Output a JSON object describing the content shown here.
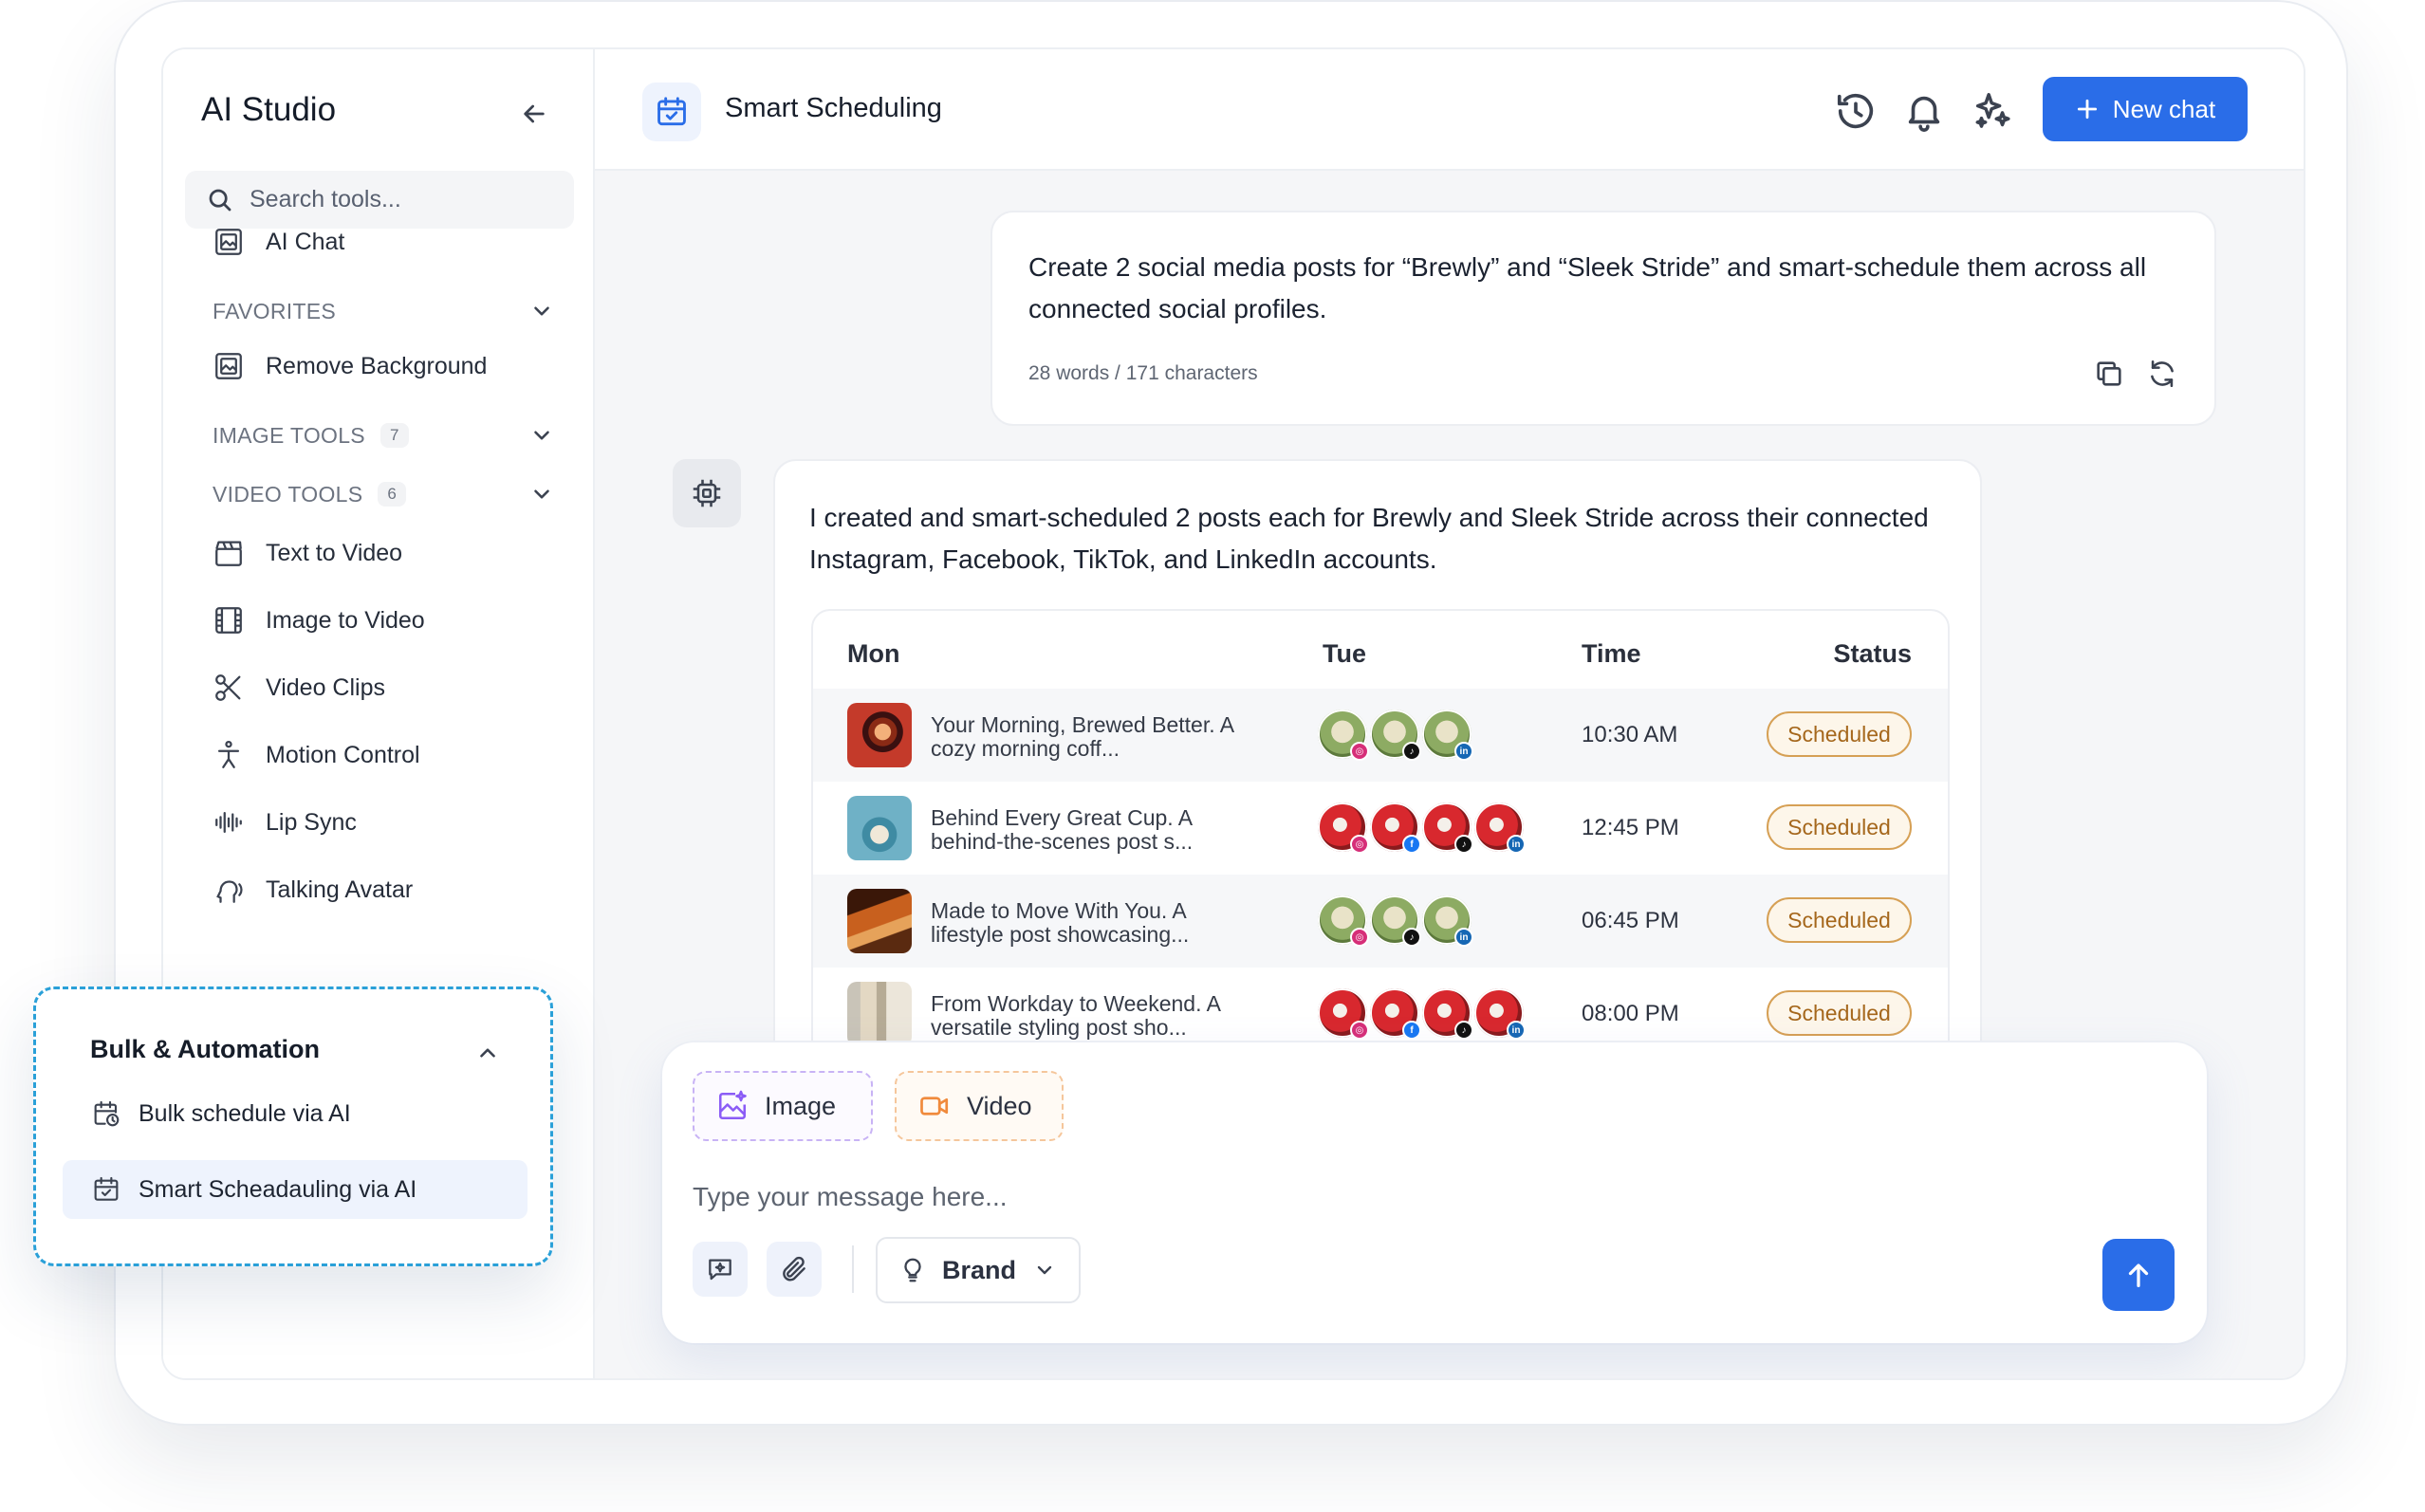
{
  "sidebar": {
    "brand": "AI Studio",
    "search_placeholder": "Search tools...",
    "ai_chat": "AI Chat",
    "favorites": "FAVORITES",
    "remove_background": "Remove Background",
    "image_tools": {
      "label": "IMAGE TOOLS",
      "count": "7"
    },
    "video_tools": {
      "label": "VIDEO TOOLS",
      "count": "6"
    },
    "video_items": [
      "Text to Video",
      "Image to Video",
      "Video Clips",
      "Motion Control",
      "Lip Sync",
      "Talking Avatar"
    ]
  },
  "bulk": {
    "title": "Bulk & Automation",
    "items": [
      "Bulk schedule via AI",
      "Smart Scheadauling via AI"
    ],
    "active_item": "Smart Scheadauling via AI"
  },
  "header": {
    "title": "Smart Scheduling",
    "new_chat": "New chat",
    "icons": [
      "history-icon",
      "bell-icon",
      "sparkles-icon"
    ]
  },
  "user_message": {
    "text": "Create 2 social media posts for “Brewly” and “Sleek Stride” and smart-schedule them across all connected social profiles.",
    "meta": "28 words / 171 characters"
  },
  "ai_message": {
    "text": "I created and smart-scheduled 2 posts each for Brewly and Sleek Stride across their connected Instagram, Facebook, TikTok, and LinkedIn accounts.",
    "table": {
      "columns": [
        "Mon",
        "Tue",
        "Time",
        "Status"
      ],
      "rows": [
        {
          "title": "Your Morning, Brewed Better. A cozy morning coff...",
          "profiles": [
            "instagram",
            "tiktok",
            "linkedin"
          ],
          "time": "10:30 AM",
          "status": "Scheduled"
        },
        {
          "title": "Behind Every Great Cup. A behind-the-scenes post s...",
          "profiles": [
            "instagram",
            "facebook",
            "tiktok",
            "linkedin"
          ],
          "time": "12:45 PM",
          "status": "Scheduled"
        },
        {
          "title": "Made to Move With You.  A lifestyle post showcasing...",
          "profiles": [
            "instagram",
            "tiktok",
            "linkedin"
          ],
          "time": "06:45 PM",
          "status": "Scheduled"
        },
        {
          "title": "From Workday to Weekend. A versatile styling post sho...",
          "profiles": [
            "instagram",
            "facebook",
            "tiktok",
            "linkedin"
          ],
          "time": "08:00 PM",
          "status": "Scheduled"
        }
      ]
    }
  },
  "composer": {
    "image_chip": "Image",
    "video_chip": "Video",
    "placeholder": "Type your message here...",
    "brand_select": "Brand"
  },
  "colors": {
    "accent": "#2a6de8",
    "status_border": "#d6a055",
    "status_text": "#a5671c",
    "dashed_frame": "#2aa0d8"
  }
}
